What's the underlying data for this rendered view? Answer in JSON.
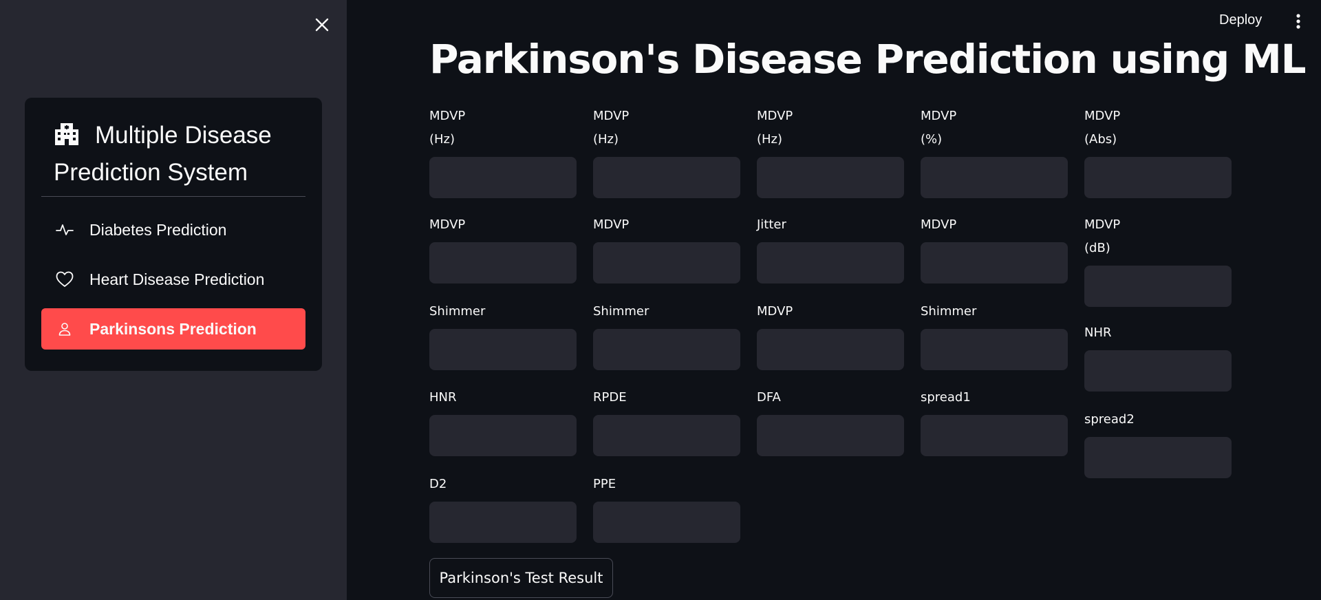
{
  "sidebar": {
    "menu_title": "Multiple Disease Prediction System",
    "items": [
      {
        "label": "Diabetes Prediction",
        "icon": "activity-icon"
      },
      {
        "label": "Heart Disease Prediction",
        "icon": "heart-icon"
      },
      {
        "label": "Parkinsons Prediction",
        "icon": "person-icon",
        "active": true
      }
    ],
    "accent_color": "#ff4b4b"
  },
  "toolbar": {
    "deploy_label": "Deploy"
  },
  "main": {
    "title": "Parkinson's Disease Prediction using ML",
    "fields": {
      "f1_1": {
        "label_line1": "MDVP",
        "label_line2": "(Hz)"
      },
      "f1_2": {
        "label_line1": "MDVP",
        "label_line2": "(Hz)"
      },
      "f1_3": {
        "label_line1": "MDVP",
        "label_line2": "(Hz)"
      },
      "f1_4": {
        "label_line1": "MDVP",
        "label_line2": "(%)"
      },
      "f1_5": {
        "label_line1": "MDVP",
        "label_line2": "(Abs)"
      },
      "f2_1": {
        "label_line1": "MDVP"
      },
      "f2_2": {
        "label_line1": "MDVP"
      },
      "f2_3": {
        "label_line1": "Jitter"
      },
      "f2_4": {
        "label_line1": "MDVP"
      },
      "f2_5": {
        "label_line1": "MDVP",
        "label_line2": "(dB)"
      },
      "f3_1": {
        "label_line1": "Shimmer"
      },
      "f3_2": {
        "label_line1": "Shimmer"
      },
      "f3_3": {
        "label_line1": "MDVP"
      },
      "f3_4": {
        "label_line1": "Shimmer"
      },
      "f3_5": {
        "label_line1": "NHR"
      },
      "f4_1": {
        "label_line1": "HNR"
      },
      "f4_2": {
        "label_line1": "RPDE"
      },
      "f4_3": {
        "label_line1": "DFA"
      },
      "f4_4": {
        "label_line1": "spread1"
      },
      "f4_5": {
        "label_line1": "spread2"
      },
      "f5_1": {
        "label_line1": "D2"
      },
      "f5_2": {
        "label_line1": "PPE"
      }
    },
    "result_button_label": "Parkinson's Test Result"
  }
}
